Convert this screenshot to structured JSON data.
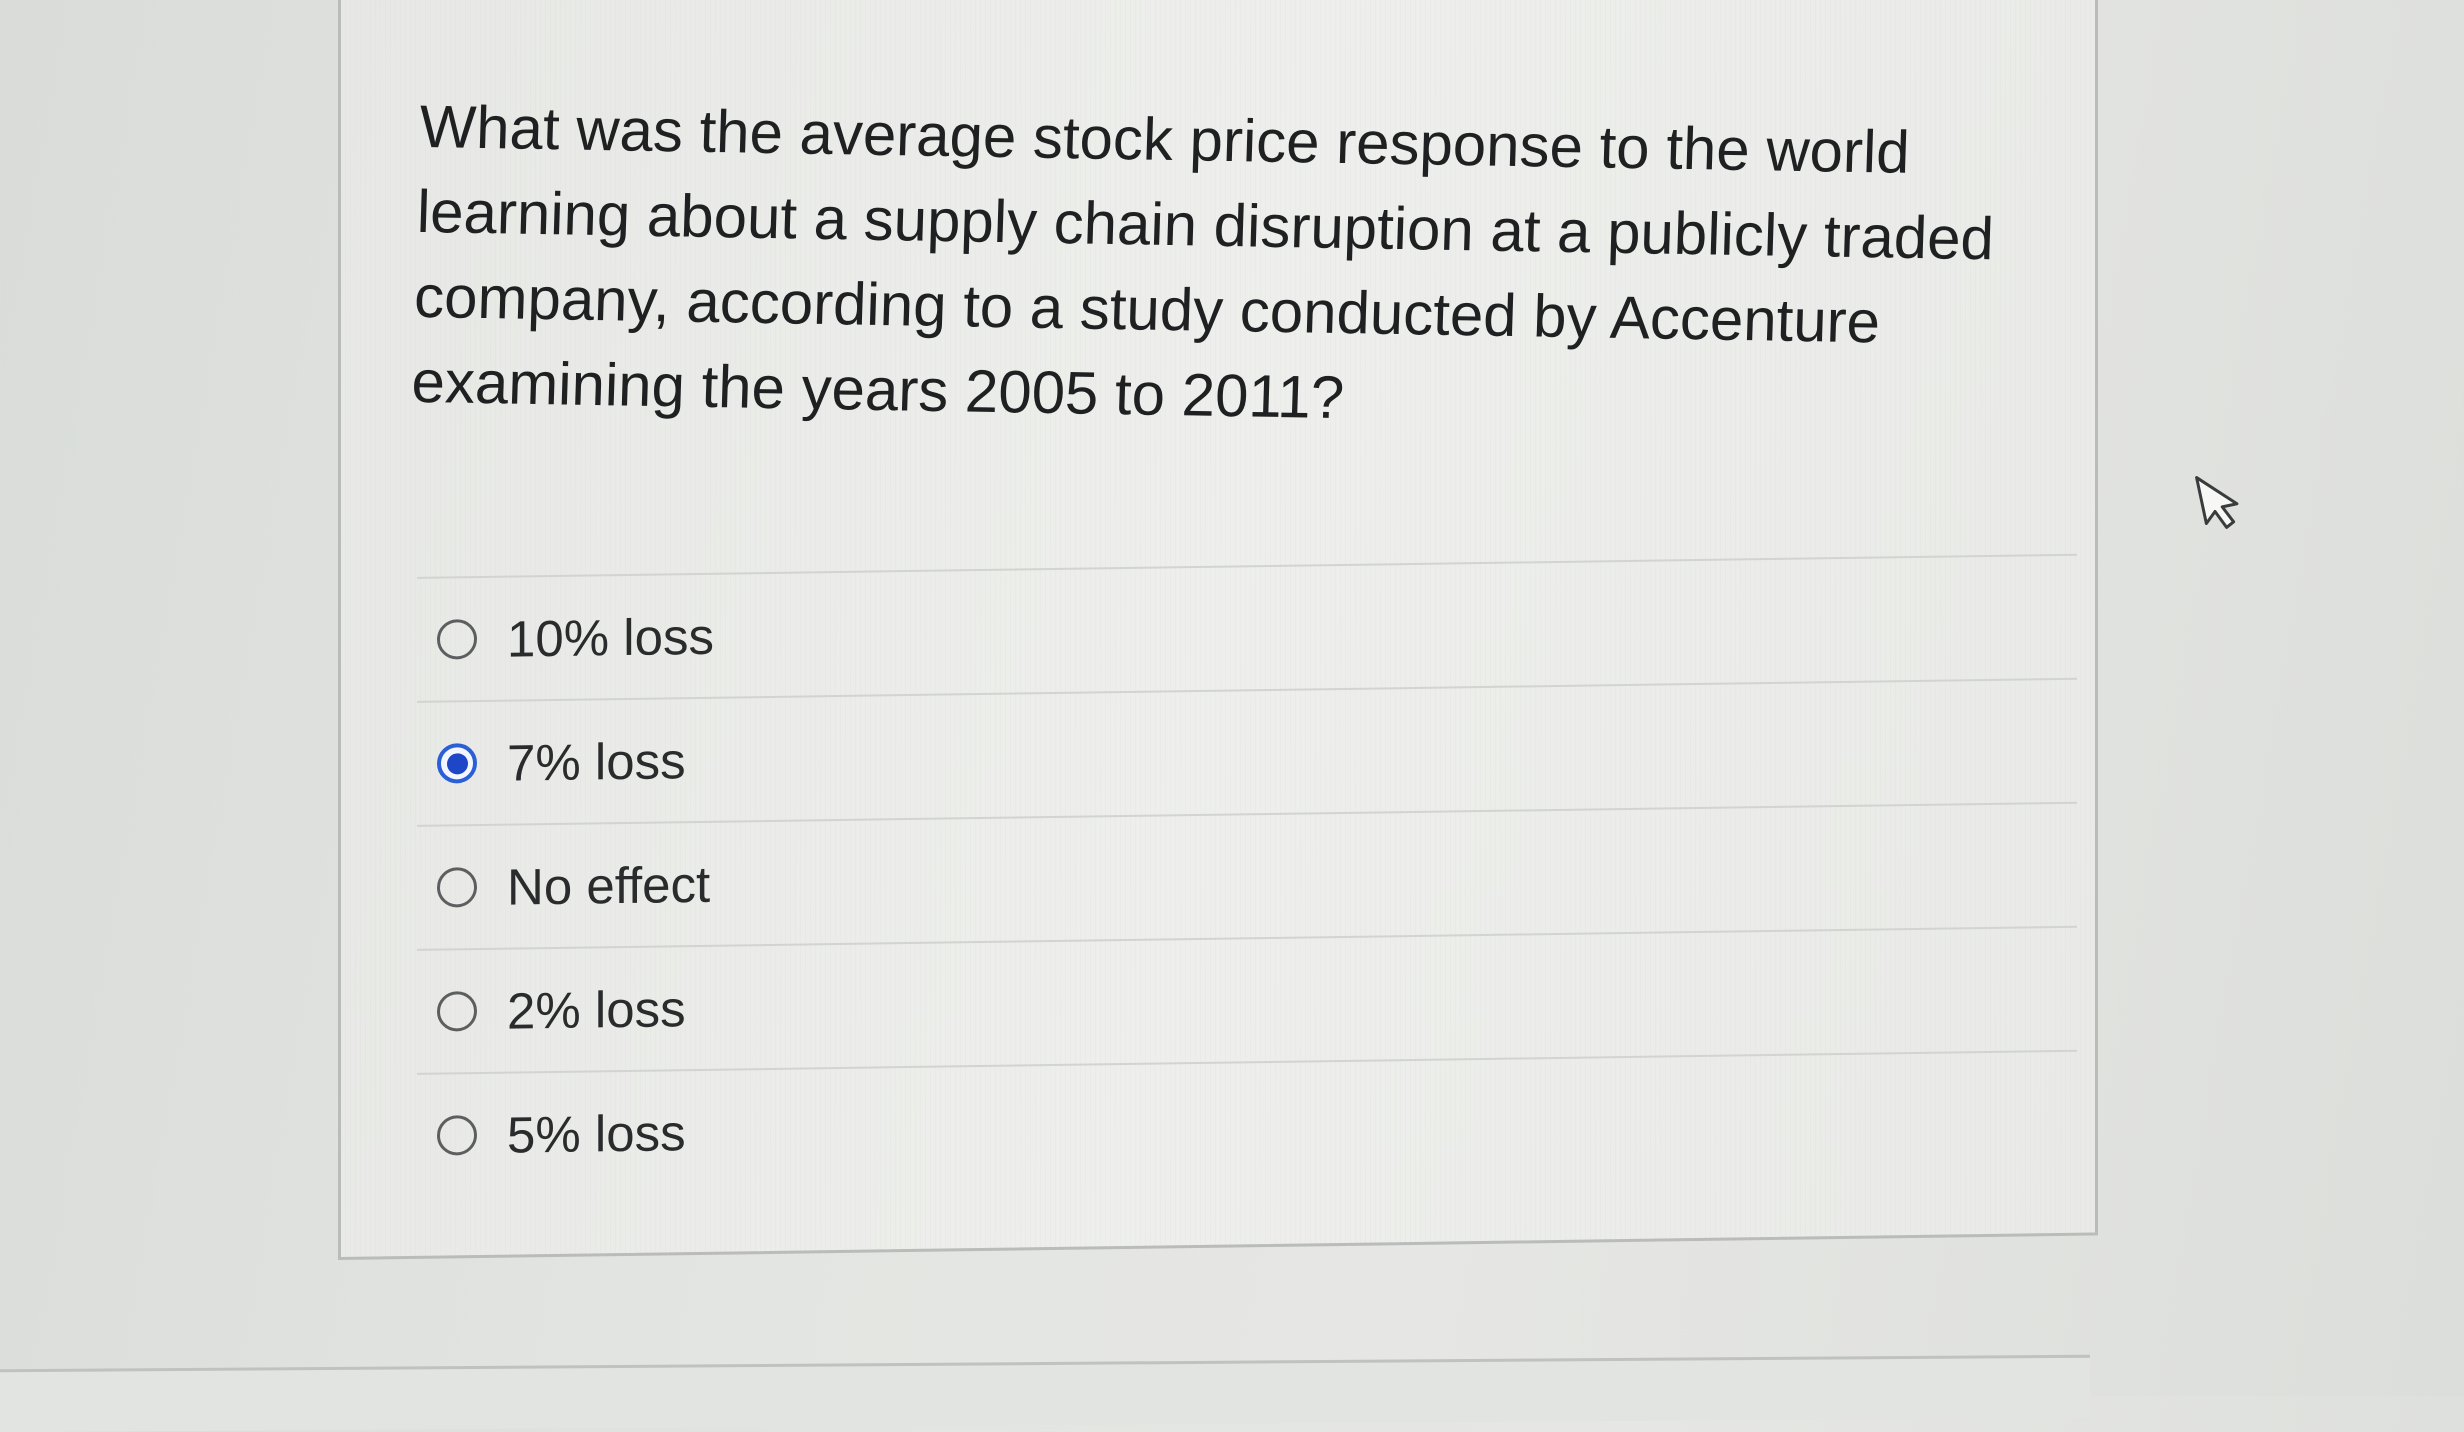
{
  "question": {
    "text": "What was the average stock price response to the world learning about a supply chain disruption at a publicly traded company, according to a study conducted by Accenture examining the years 2005 to 2011?"
  },
  "answers": [
    {
      "label": "10% loss",
      "selected": false
    },
    {
      "label": "7% loss",
      "selected": true
    },
    {
      "label": "No effect",
      "selected": false
    },
    {
      "label": "2% loss",
      "selected": false
    },
    {
      "label": "5% loss",
      "selected": false
    }
  ],
  "colors": {
    "selected_radio": "#1d47c7",
    "text": "#1f2021"
  },
  "icons": {
    "cursor": "mouse-pointer-icon"
  }
}
